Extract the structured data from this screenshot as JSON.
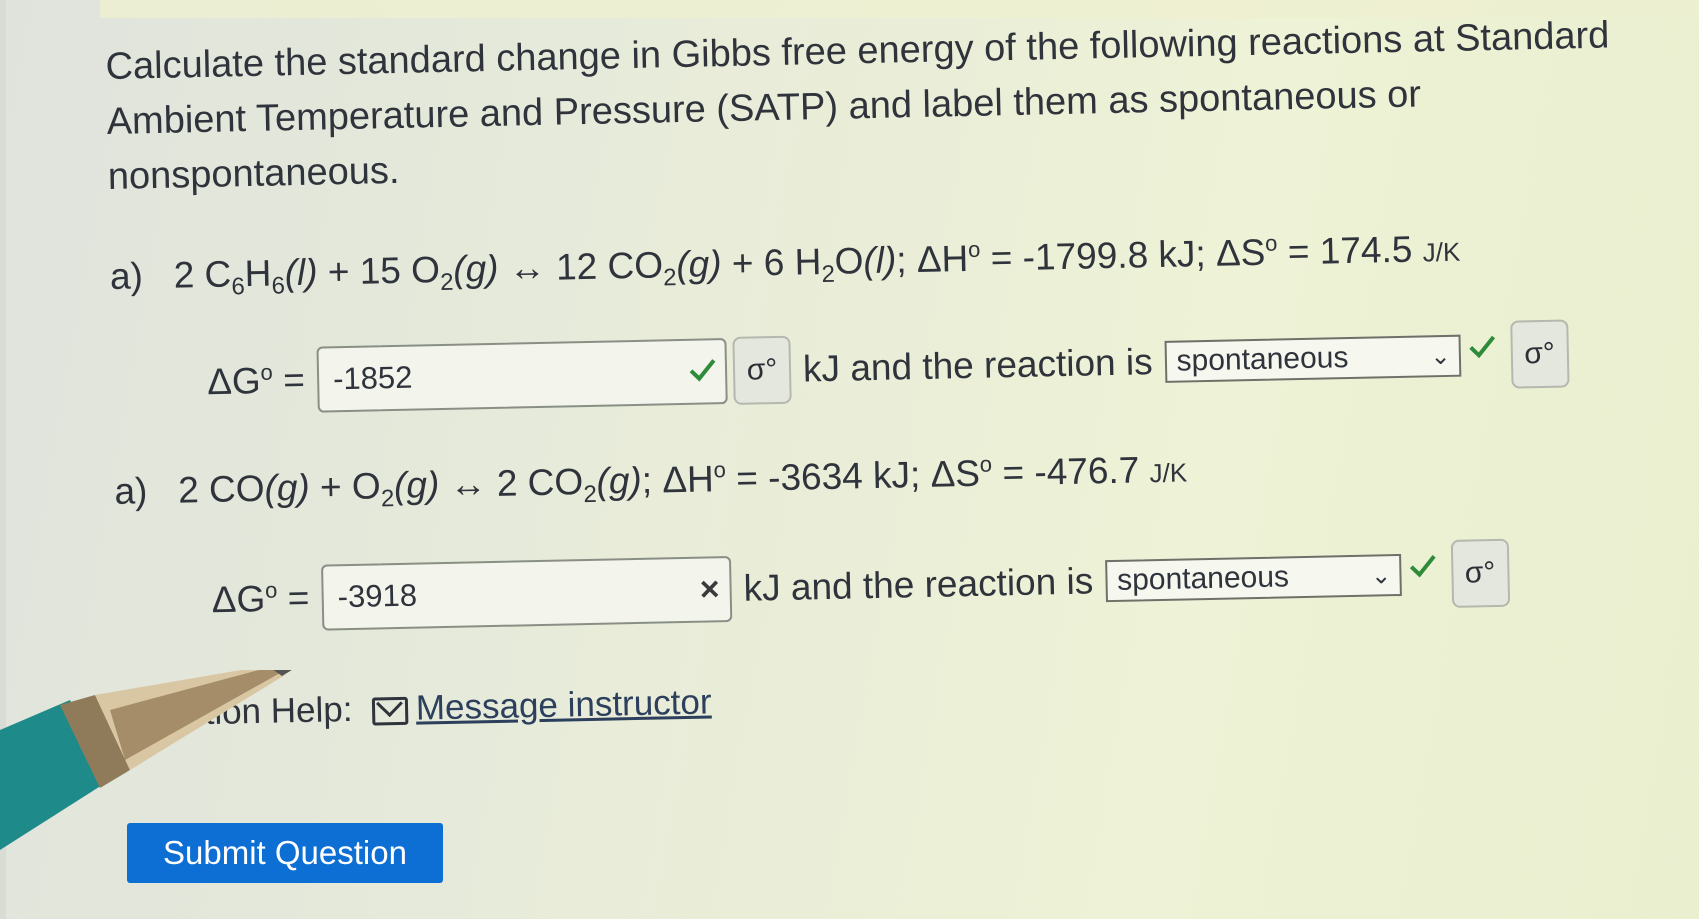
{
  "prompt": "Calculate the standard change in Gibbs free energy of the following reactions at Standard Ambient Temperature and Pressure (SATP) and label them as spontaneous or nonspontaneous.",
  "reaction1": {
    "label": "a)",
    "coef1": "2 C",
    "sub1": "6",
    "mid1": "H",
    "sub2": "6",
    "phase1": "(l)",
    "plus1": " + 15 O",
    "sub3": "2",
    "phase2": "(g)",
    "arrow": " ↔ 12 CO",
    "sub4": "2",
    "phase3": "(g)",
    "plus2": " + 6 H",
    "sub5": "2",
    "o": "O",
    "phase4": "(l)",
    "semi": ";",
    "dh": " ΔH",
    "sup": "o",
    "dh_val": " = -1799.8 kJ; ΔS",
    "ds_val": " = 174.5 ",
    "unit": "J/K",
    "dg_label": "ΔG",
    "dg_eq": " =",
    "answer": "-1852",
    "status": "correct",
    "mid_text": "kJ and the reaction is",
    "select_value": "spontaneous",
    "key_icon": "σ°"
  },
  "reaction2": {
    "label": "a)",
    "text1": "2 CO",
    "phase1": "(g)",
    "plus": " + O",
    "sub1": "2",
    "phase2": "(g)",
    "arrow": " ↔ 2 CO",
    "sub2": "2",
    "phase3": "(g)",
    "semi": ";",
    "dh": " ΔH",
    "sup": "o",
    "dh_val": " = -3634 kJ; ΔS",
    "ds_val": " = -476.7 ",
    "unit": "J/K",
    "dg_label": "ΔG",
    "dg_eq": " =",
    "answer": "-3918",
    "status": "incorrect",
    "mark": "×",
    "mid_text": "kJ and the reaction is",
    "select_value": "spontaneous",
    "key_icon": "σ°"
  },
  "help": {
    "label": "stion Help:",
    "link": "Message instructor"
  },
  "submit": {
    "label": "Submit Question"
  },
  "colors": {
    "submit_bg": "#0d6ed3",
    "check": "#2e8b3a"
  }
}
